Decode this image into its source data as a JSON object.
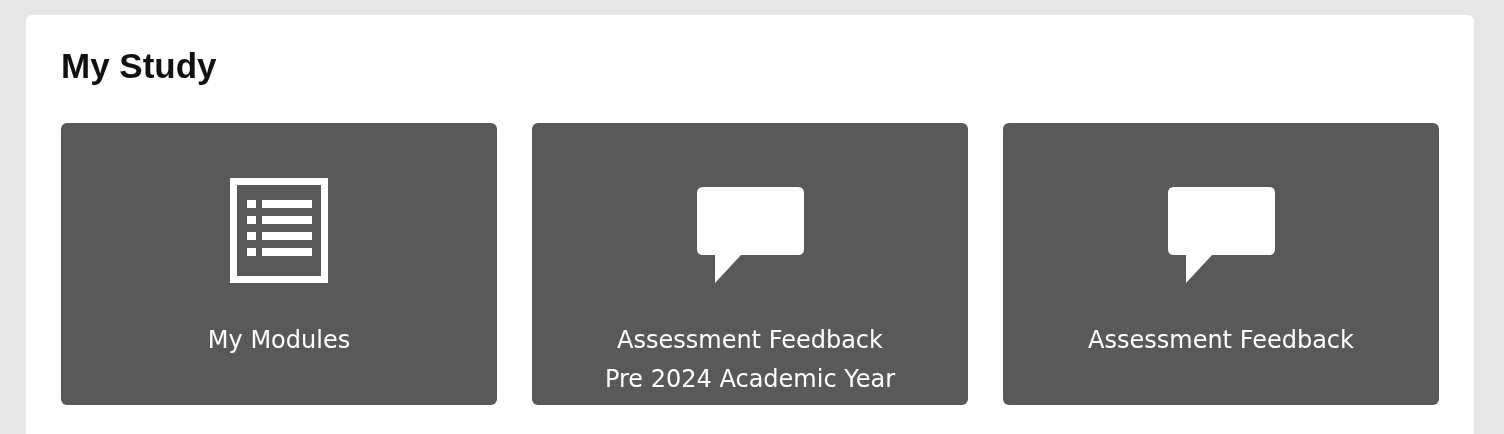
{
  "section": {
    "title": "My Study"
  },
  "tiles": [
    {
      "label": "My Modules",
      "kind": "list"
    },
    {
      "label": "Assessment Feedback\nPre 2024 Academic Year",
      "kind": "chat"
    },
    {
      "label": "Assessment Feedback",
      "kind": "chat"
    }
  ]
}
